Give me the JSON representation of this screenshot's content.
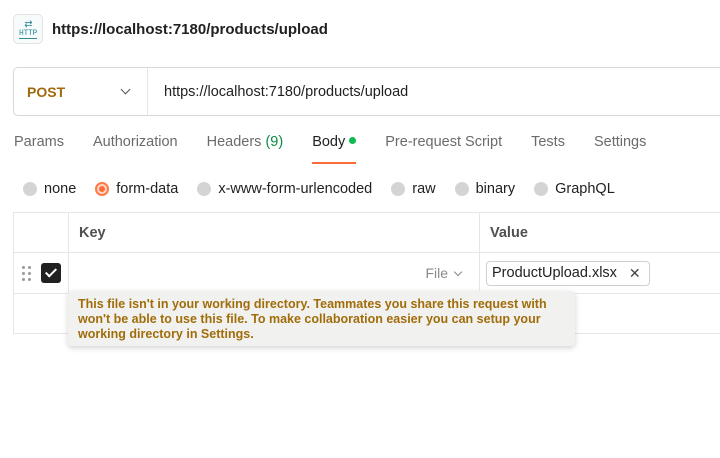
{
  "title": "https://localhost:7180/products/upload",
  "icon": {
    "name": "http-icon",
    "text": "HTTP"
  },
  "request": {
    "method": "POST",
    "url": "https://localhost:7180/products/upload"
  },
  "tabs": [
    {
      "label": "Params"
    },
    {
      "label": "Authorization"
    },
    {
      "label": "Headers",
      "count": "(9)"
    },
    {
      "label": "Body",
      "active": true
    },
    {
      "label": "Pre-request Script"
    },
    {
      "label": "Tests"
    },
    {
      "label": "Settings"
    }
  ],
  "body_types": [
    {
      "label": "none"
    },
    {
      "label": "form-data",
      "selected": true
    },
    {
      "label": "x-www-form-urlencoded"
    },
    {
      "label": "raw"
    },
    {
      "label": "binary"
    },
    {
      "label": "GraphQL"
    }
  ],
  "table": {
    "headers": {
      "key": "Key",
      "value": "Value"
    },
    "row": {
      "checked": true,
      "type_label": "File",
      "file_name": "ProductUpload.xlsx",
      "remove_symbol": "✕"
    }
  },
  "tooltip": "This file isn't in your working directory. Teammates you share this request with won't be able to use this file. To make collaboration easier you can setup your working directory in Settings.",
  "colors": {
    "method": "#a0690c",
    "accent": "#ff6c37",
    "headers_count": "#0c8a43",
    "body_dot": "#0cbb52",
    "tooltip_text": "#a06d0a"
  }
}
